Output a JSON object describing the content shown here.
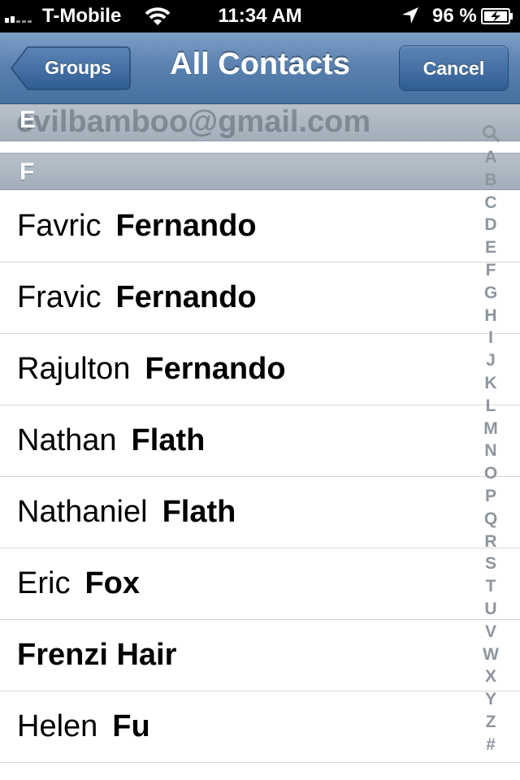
{
  "status_bar": {
    "carrier": "T-Mobile",
    "time": "11:34 AM",
    "battery_percent": "96 %",
    "icons": [
      "signal-bars-icon",
      "wifi-icon",
      "location-arrow-icon",
      "battery-charging-icon"
    ]
  },
  "nav": {
    "title": "All Contacts",
    "back_label": "Groups",
    "cancel_label": "Cancel",
    "bar_color": "#5b82b1"
  },
  "sections": [
    {
      "letter": "E",
      "peek_text": "evilbamboo@gmail.com"
    },
    {
      "letter": "F"
    }
  ],
  "contacts": [
    {
      "first": "Favric",
      "last": "Fernando"
    },
    {
      "first": "Fravic",
      "last": "Fernando"
    },
    {
      "first": "Rajulton",
      "last": "Fernando"
    },
    {
      "first": "Nathan",
      "last": "Flath"
    },
    {
      "first": "Nathaniel",
      "last": "Flath"
    },
    {
      "first": "Eric",
      "last": "Fox"
    },
    {
      "first": "Frenzi Hair",
      "last": ""
    },
    {
      "first": "Helen",
      "last": "Fu"
    }
  ],
  "index": {
    "search_icon": "search-icon",
    "letters": [
      "A",
      "B",
      "C",
      "D",
      "E",
      "F",
      "G",
      "H",
      "I",
      "J",
      "K",
      "L",
      "M",
      "N",
      "O",
      "P",
      "Q",
      "R",
      "S",
      "T",
      "U",
      "V",
      "W",
      "X",
      "Y",
      "Z",
      "#"
    ]
  }
}
